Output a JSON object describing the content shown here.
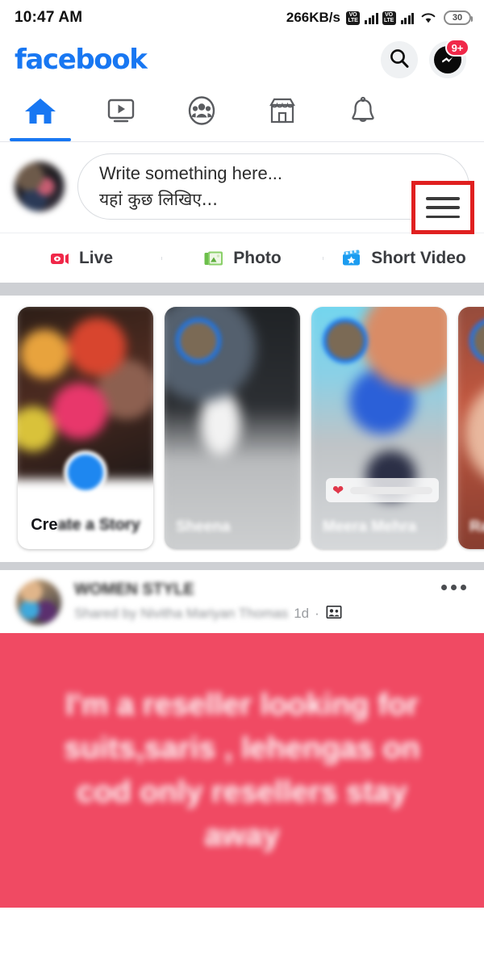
{
  "status_bar": {
    "time": "10:47 AM",
    "network_speed": "266KB/s",
    "volte_label_top": "VO",
    "volte_label_bottom": "LTE",
    "battery_level": "30"
  },
  "header": {
    "logo_text": "facebook",
    "search_icon": "search-icon",
    "messenger_icon": "messenger-icon",
    "messenger_badge": "9+"
  },
  "nav_tabs": [
    {
      "name": "home",
      "icon": "home-icon",
      "active": true
    },
    {
      "name": "watch",
      "icon": "video-play-icon",
      "active": false
    },
    {
      "name": "groups",
      "icon": "groups-icon",
      "active": false
    },
    {
      "name": "marketplace",
      "icon": "marketplace-icon",
      "active": false
    },
    {
      "name": "notifications",
      "icon": "bell-icon",
      "active": false
    },
    {
      "name": "menu",
      "icon": "hamburger-menu-icon",
      "active": false
    }
  ],
  "highlight": {
    "target": "hamburger-menu-icon",
    "color": "#e02020"
  },
  "composer": {
    "placeholder_line1": "Write something here...",
    "placeholder_line2": "यहां कुछ लिखिए..."
  },
  "actions": [
    {
      "label": "Live",
      "icon": "live-video-icon",
      "color": "#f02849"
    },
    {
      "label": "Photo",
      "icon": "photo-icon",
      "color": "#45bd62"
    },
    {
      "label": "Short Video",
      "icon": "short-video-icon",
      "color": "#1b9cf0"
    }
  ],
  "stories": [
    {
      "type": "create",
      "label_plain": "Cre",
      "label_blur": "ate a Story",
      "full_label": "Create a Story"
    },
    {
      "type": "story",
      "name": "Sheena"
    },
    {
      "type": "story",
      "name": "Meera Mehra",
      "has_sticker": true,
      "sticker_icon": "heart-icon"
    },
    {
      "type": "story",
      "name": "Ram"
    }
  ],
  "post": {
    "page_name": "WOMEN STYLE",
    "shared_by": "Shared by Nivitha Mariyan Thomas",
    "timestamp": "1d",
    "privacy_icon": "group-members-icon",
    "menu_icon": "more-options-icon",
    "text": "I'm a reseller looking for suits,saris , lehengas on cod only resellers stay away",
    "background_color": "#f04a63"
  }
}
